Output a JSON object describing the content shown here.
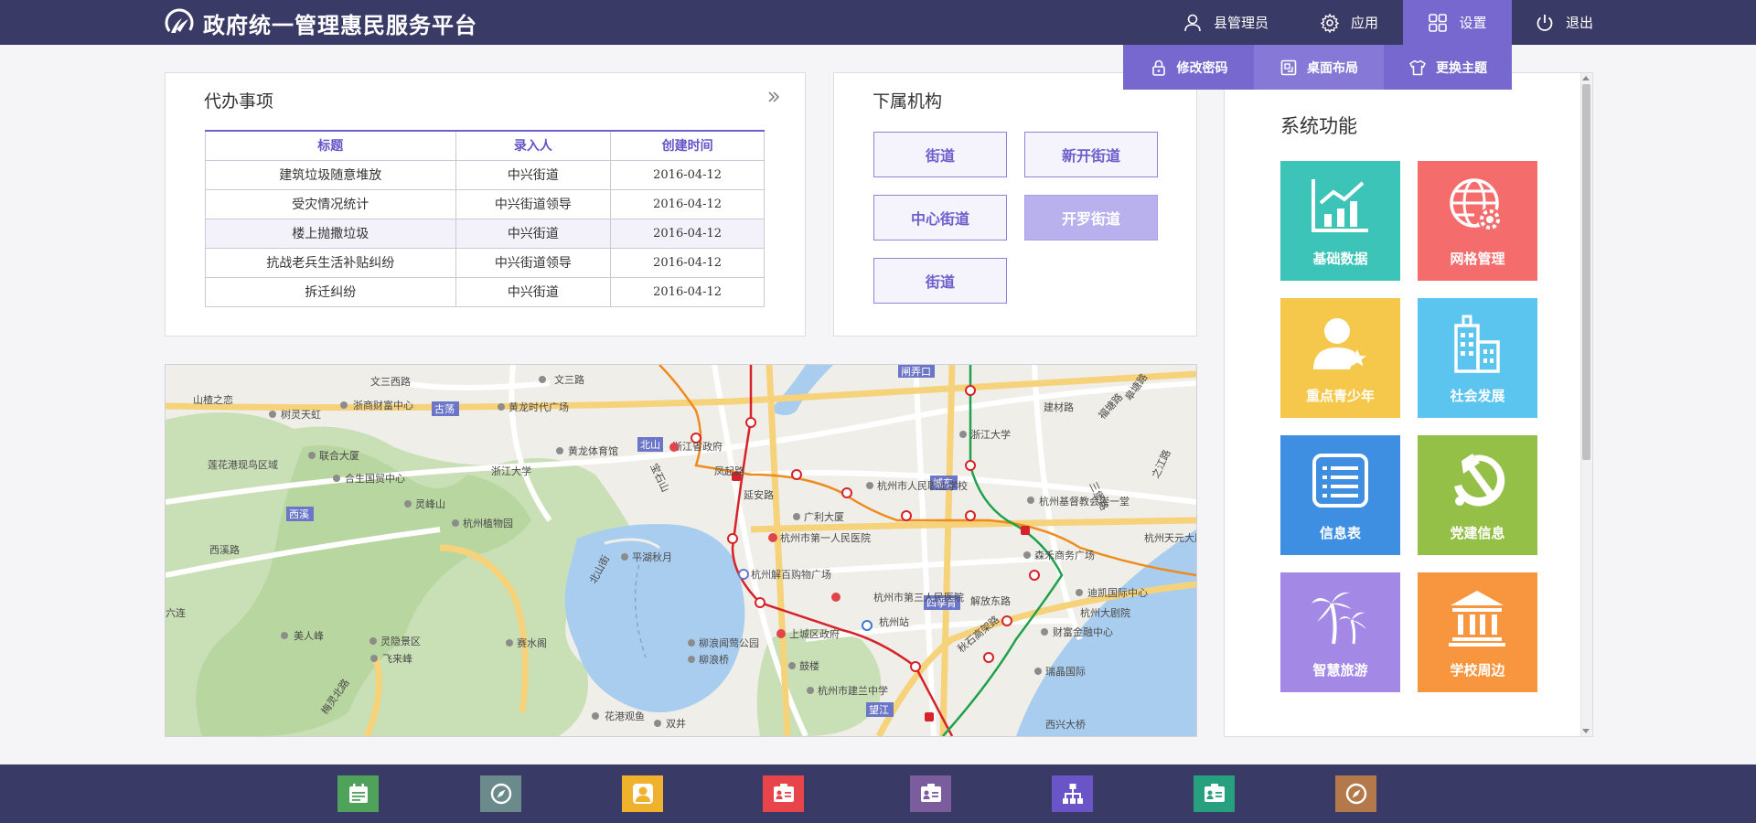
{
  "app": {
    "title": "政府统一管理惠民服务平台"
  },
  "nav": {
    "user_label": "县管理员",
    "app_label": "应用",
    "settings_label": "设置",
    "logout_label": "退出"
  },
  "settings_menu": {
    "change_password": "修改密码",
    "desktop_layout": "桌面布局",
    "change_theme": "更换主题"
  },
  "todo": {
    "title": "代办事项",
    "columns": [
      "标题",
      "录入人",
      "创建时间"
    ],
    "rows": [
      {
        "title": "建筑垃圾随意堆放",
        "author": "中兴街道",
        "created": "2016-04-12"
      },
      {
        "title": "受灾情况统计",
        "author": "中兴街道领导",
        "created": "2016-04-12"
      },
      {
        "title": "楼上抛撒垃圾",
        "author": "中兴街道",
        "created": "2016-04-12"
      },
      {
        "title": "抗战老兵生活补贴纠纷",
        "author": "中兴街道领导",
        "created": "2016-04-12"
      },
      {
        "title": "拆迁纠纷",
        "author": "中兴街道",
        "created": "2016-04-12"
      }
    ]
  },
  "orgs": {
    "title": "下属机构",
    "items": [
      "街道",
      "新开街道",
      "中心街道",
      "开罗街道",
      "街道"
    ],
    "active_index": 3
  },
  "functions": {
    "title": "系统功能",
    "tiles": [
      {
        "label": "基础数据",
        "color": "#3cc4b8",
        "icon": "chart-icon"
      },
      {
        "label": "网格管理",
        "color": "#f56c6c",
        "icon": "globe-gear-icon"
      },
      {
        "label": "重点青少年",
        "color": "#f5c84c",
        "icon": "person-star-icon"
      },
      {
        "label": "社会发展",
        "color": "#5bc4ef",
        "icon": "buildings-icon"
      },
      {
        "label": "信息表",
        "color": "#3e8ee2",
        "icon": "list-icon"
      },
      {
        "label": "党建信息",
        "color": "#95c047",
        "icon": "hammer-sickle-icon"
      },
      {
        "label": "智慧旅游",
        "color": "#a388e6",
        "icon": "palm-tree-icon"
      },
      {
        "label": "学校周边",
        "color": "#f7963e",
        "icon": "school-icon"
      }
    ]
  },
  "map": {
    "labels": [
      "文三西路",
      "文三路",
      "古荡",
      "黄龙时代广场",
      "浙商财富中心",
      "山楂之恋",
      "树灵天虹",
      "联合大厦",
      "莲花港现鸟区域",
      "合生国贸中心",
      "浙江大学",
      "黄龙体育馆",
      "北山",
      "浙江省政府",
      "宝石山",
      "凤起路",
      "杭州市人民职业学校",
      "城东",
      "浙江大学",
      "建材路",
      "杭州基督教会崇一堂",
      "灵峰山",
      "杭州植物园",
      "广利大厦",
      "延安路",
      "杭州市第一人民医院",
      "森禾商务广场",
      "杭州天元大厦",
      "西溪",
      "西溪路",
      "平湖秋月",
      "北山街",
      "杭州解百购物广场",
      "杭州市第三人民医院",
      "四季青",
      "解放东路",
      "迪凯国际中心",
      "杭州大剧院",
      "美人峰",
      "灵隐景区",
      "赛水阁",
      "柳浪闻莺公园",
      "上城区政府",
      "杭州站",
      "秋石高架路",
      "财富金融中心",
      "飞来峰",
      "柳浪桥",
      "鼓楼",
      "瑞晶国际",
      "杭州市建兰中学",
      "望江",
      "梅灵北路",
      "花港观鱼",
      "双井",
      "西兴大桥",
      "闸弄口",
      "皋塘路",
      "福塘路",
      "三堡路",
      "之江路",
      "六连",
      "宝石"
    ]
  },
  "footer": {
    "icons": [
      {
        "name": "calendar-icon",
        "color": "#4ea25a"
      },
      {
        "name": "compass-icon",
        "color": "#6b8a8c"
      },
      {
        "name": "user-icon",
        "color": "#f0b22c"
      },
      {
        "name": "id-card-icon",
        "color": "#e8454b"
      },
      {
        "name": "contact-card-icon",
        "color": "#7b5c9c"
      },
      {
        "name": "org-chart-icon",
        "color": "#6a55c8"
      },
      {
        "name": "badge-icon",
        "color": "#27a07f"
      },
      {
        "name": "navigate-icon",
        "color": "#b4794a"
      }
    ]
  }
}
